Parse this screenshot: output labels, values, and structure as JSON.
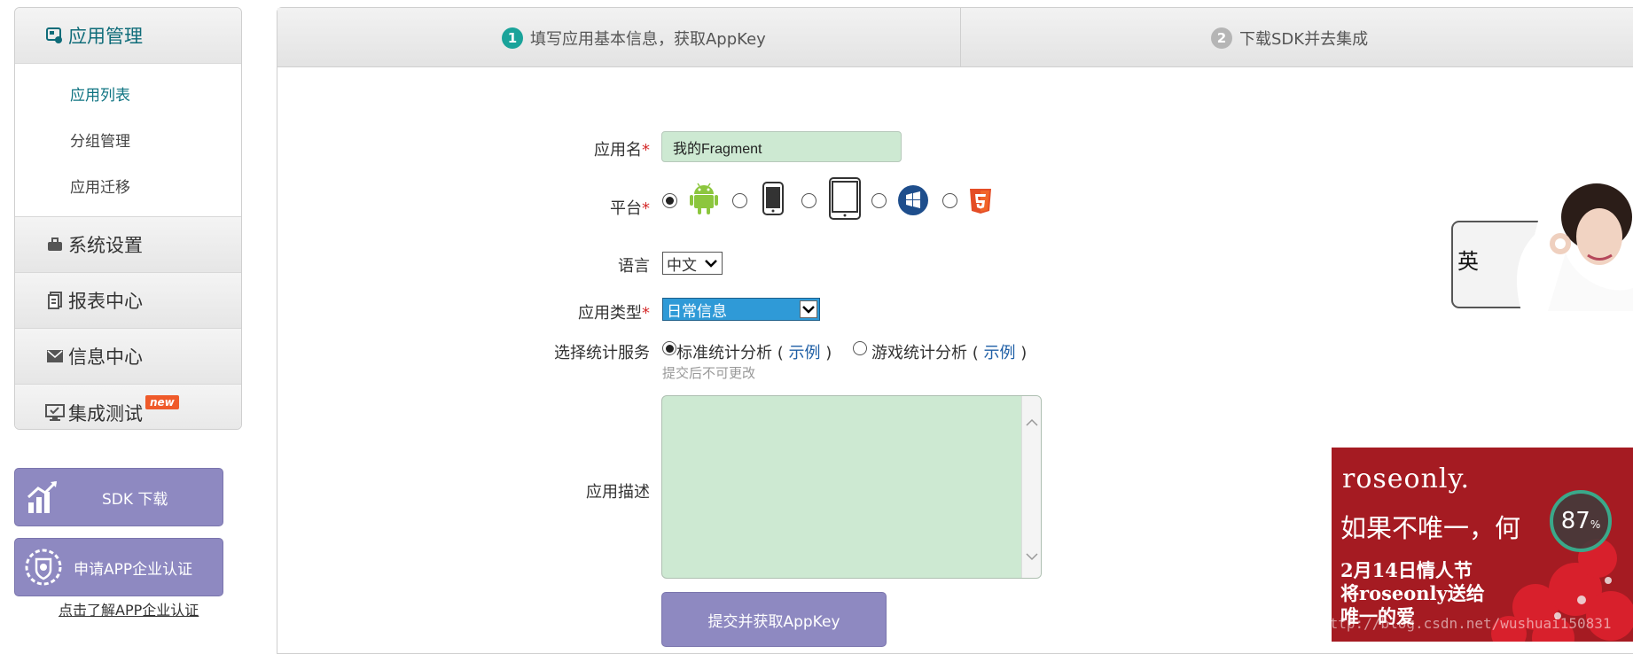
{
  "sidebar": {
    "app_mgmt": "应用管理",
    "sub_items": [
      "应用列表",
      "分组管理",
      "应用迁移"
    ],
    "system_settings": "系统设置",
    "report_center": "报表中心",
    "message_center": "信息中心",
    "integration_test": "集成测试",
    "new_badge": "new"
  },
  "sdk_button": "SDK 下载",
  "cert_button": "申请APP企业认证",
  "cert_link": "点击了解APP企业认证",
  "steps": [
    {
      "num": "1",
      "label": "填写应用基本信息，获取AppKey"
    },
    {
      "num": "2",
      "label": "下载SDK并去集成"
    }
  ],
  "form": {
    "name_label": "应用名",
    "name_value": "我的Fragment",
    "platform_label": "平台",
    "platforms": [
      "android-icon",
      "phone-icon",
      "tablet-icon",
      "windows-icon",
      "html5-icon"
    ],
    "language_label": "语言",
    "language_value": "中文",
    "type_label": "应用类型",
    "type_value": "日常信息",
    "service_label": "选择统计服务",
    "service_standard": "标准统计分析",
    "service_game": "游戏统计分析",
    "example_link": "示例",
    "paren_open": "(",
    "paren_close": ")",
    "hint": "提交后不可更改",
    "desc_label": "应用描述",
    "required_mark": "*",
    "submit": "提交并获取AppKey"
  },
  "ads": {
    "person_text": "英",
    "rose_brand": "roseonly.",
    "rose_line1": "如果不唯一，何",
    "rose_line2a": "2月14日情人节",
    "rose_line2b": "将roseonly送给",
    "rose_line2c": "唯一的爱",
    "perf_value": "87",
    "perf_unit": "%"
  },
  "watermark": "http://blog.csdn.net/wushuai150831",
  "colors": {
    "accent_teal": "#0f6c79",
    "button_purple": "#8e89c1",
    "input_green": "#cde9d2",
    "required_red": "#d42b2b",
    "link_blue": "#1f5fa6"
  }
}
